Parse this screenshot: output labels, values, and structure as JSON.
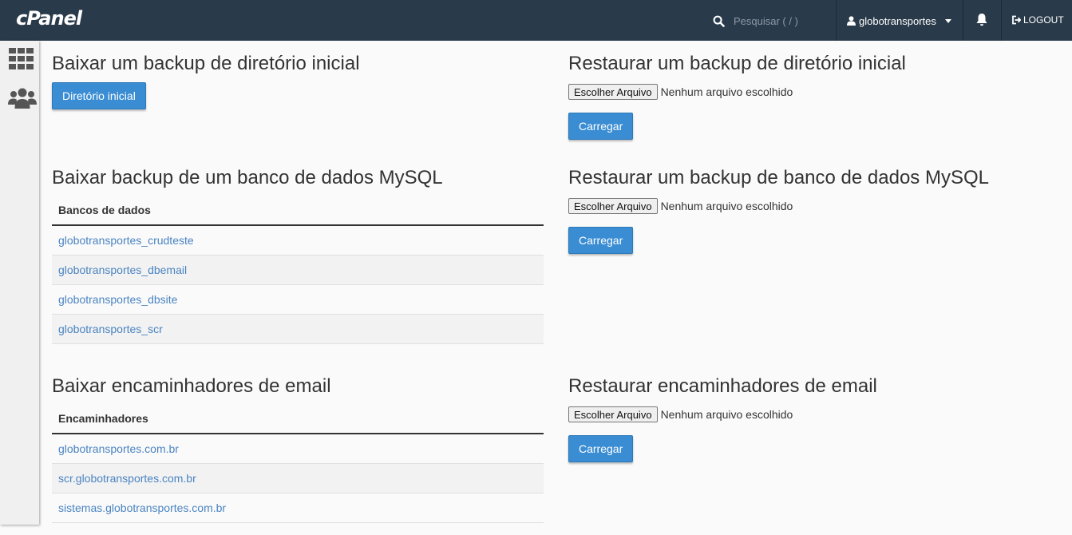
{
  "topbar": {
    "logo": "cPanel",
    "search_placeholder": "Pesquisar ( / )",
    "username": "globotransportes",
    "logout_label": "LOGOUT"
  },
  "sections": {
    "home_download": {
      "title": "Baixar um backup de diretório inicial",
      "button": "Diretório inicial"
    },
    "home_restore": {
      "title": "Restaurar um backup de diretório inicial",
      "file_button": "Escolher Arquivo",
      "file_status": "Nenhum arquivo escolhido",
      "upload": "Carregar"
    },
    "mysql_download": {
      "title": "Baixar backup de um banco de dados MySQL",
      "column": "Bancos de dados",
      "rows": [
        "globotransportes_crudteste",
        "globotransportes_dbemail",
        "globotransportes_dbsite",
        "globotransportes_scr"
      ]
    },
    "mysql_restore": {
      "title": "Restaurar um backup de banco de dados MySQL",
      "file_button": "Escolher Arquivo",
      "file_status": "Nenhum arquivo escolhido",
      "upload": "Carregar"
    },
    "email_download": {
      "title": "Baixar encaminhadores de email",
      "column": "Encaminhadores",
      "rows": [
        "globotransportes.com.br",
        "scr.globotransportes.com.br",
        "sistemas.globotransportes.com.br"
      ]
    },
    "email_restore": {
      "title": "Restaurar encaminhadores de email",
      "file_button": "Escolher Arquivo",
      "file_status": "Nenhum arquivo escolhido",
      "upload": "Carregar"
    }
  },
  "colors": {
    "topbar": "#293a4a",
    "primary": "#3a8dd3",
    "link": "#4a84c2"
  }
}
